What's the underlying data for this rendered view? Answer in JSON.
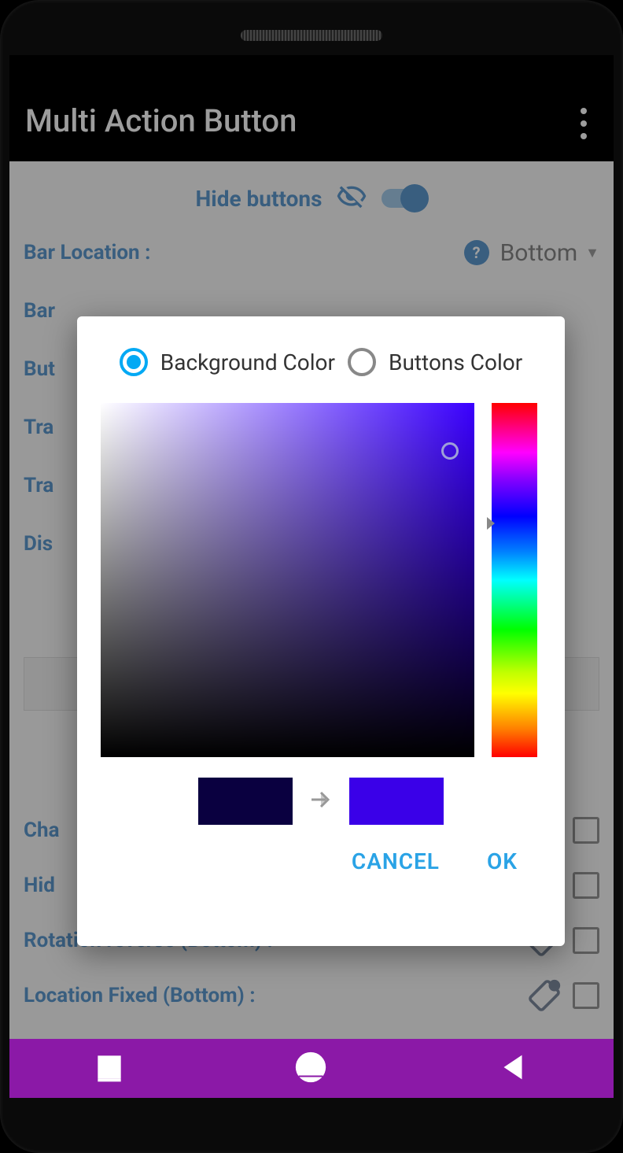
{
  "header": {
    "title": "Multi Action Button"
  },
  "hide_buttons": {
    "label": "Hide buttons",
    "on": true
  },
  "settings": {
    "bar_location": {
      "label": "Bar Location :",
      "value": "Bottom"
    },
    "bar_": {
      "label": "Bar"
    },
    "buttons_": {
      "label": "But"
    },
    "tra1": {
      "label": "Tra"
    },
    "tra2": {
      "label": "Tra"
    },
    "dis": {
      "label": "Dis"
    }
  },
  "options": {
    "change": {
      "label": "Cha"
    },
    "hide": {
      "label": "Hid"
    },
    "rotation": {
      "label": "Rotation reverse (Bottom) :"
    },
    "location_fixed": {
      "label": "Location Fixed (Bottom) :"
    }
  },
  "dialog": {
    "radio_bg": "Background Color",
    "radio_btn": "Buttons Color",
    "selected": "bg",
    "old_color": "#0a0040",
    "new_color": "#3a00e8",
    "cancel": "CANCEL",
    "ok": "OK"
  }
}
